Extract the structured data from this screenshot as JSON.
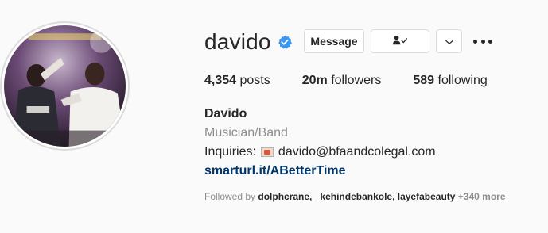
{
  "profile": {
    "username": "davido",
    "verified": true,
    "accent_color": "#3897f0"
  },
  "buttons": {
    "message_label": "Message",
    "follow_icon": "person-check-icon",
    "chevron_icon": "chevron-down-icon",
    "more_icon": "more-horizontal-icon"
  },
  "stats": {
    "posts_count": "4,354",
    "posts_label": " posts",
    "followers_count": "20m",
    "followers_label": " followers",
    "following_count": "589",
    "following_label": " following"
  },
  "bio": {
    "name": "Davido",
    "category": "Musician/Band",
    "inquiries_label": "Inquiries:",
    "email": "davido@bfaandcolegal.com",
    "link": "smarturl.it/ABetterTime"
  },
  "followed_by": {
    "prefix": "Followed by ",
    "names": "dolphcrane, _kehindebankole, layefabeauty",
    "more": " +340 more"
  }
}
